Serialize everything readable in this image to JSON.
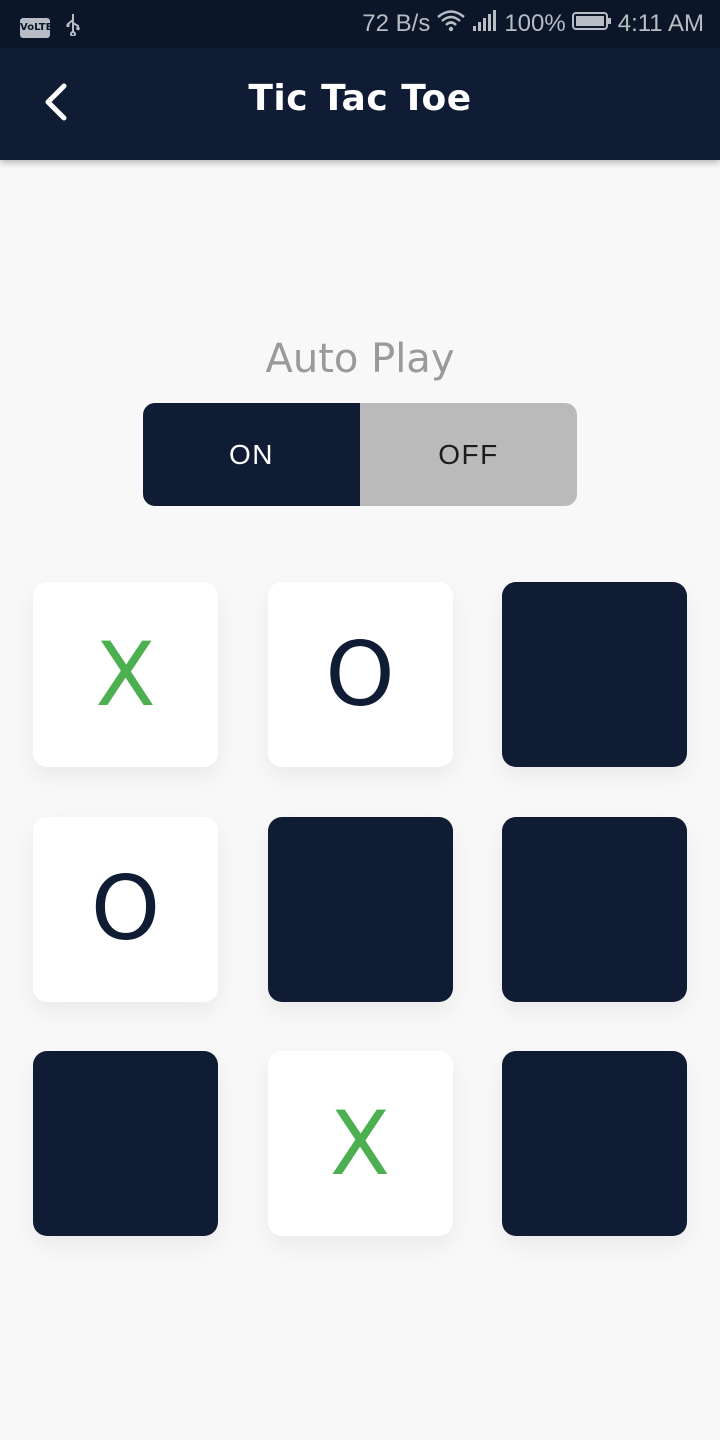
{
  "status_bar": {
    "volte": "VoLTE",
    "network_speed": "72 B/s",
    "battery": "100%",
    "time": "4:11 AM"
  },
  "app_bar": {
    "title": "Tic Tac Toe",
    "back_icon": "chevron-left-icon"
  },
  "auto_play": {
    "label": "Auto Play",
    "on_label": "ON",
    "off_label": "OFF",
    "selected": "ON"
  },
  "board": {
    "cells": [
      "X",
      "O",
      "",
      "O",
      "",
      "",
      "",
      "X",
      ""
    ]
  },
  "colors": {
    "primary": "#0f1c33",
    "status_bar": "#0b1729",
    "x_mark": "#4caf50",
    "o_mark": "#0f1c33",
    "filled_cell": "#ffffff",
    "toggle_off": "#bababa",
    "background": "#f8f8f8"
  }
}
